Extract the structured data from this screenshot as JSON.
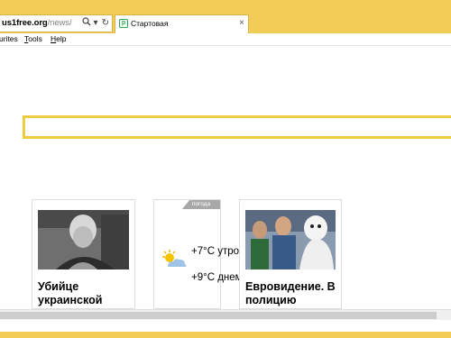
{
  "address_bar": {
    "url_bold": "us1free.org",
    "url_dim": "/news/"
  },
  "tab": {
    "title": "Стартовая"
  },
  "menu": {
    "items": [
      "urites",
      "Tools",
      "Help"
    ]
  },
  "cards": [
    {
      "title": "Убийце украинской"
    },
    {
      "tag": "погода",
      "lines": [
        "+7°C утром",
        "+9°C днем"
      ]
    },
    {
      "title": "Евровидение. В полицию"
    }
  ],
  "colors": {
    "chrome": "#f3cb57",
    "search_border": "#f0cc43"
  }
}
